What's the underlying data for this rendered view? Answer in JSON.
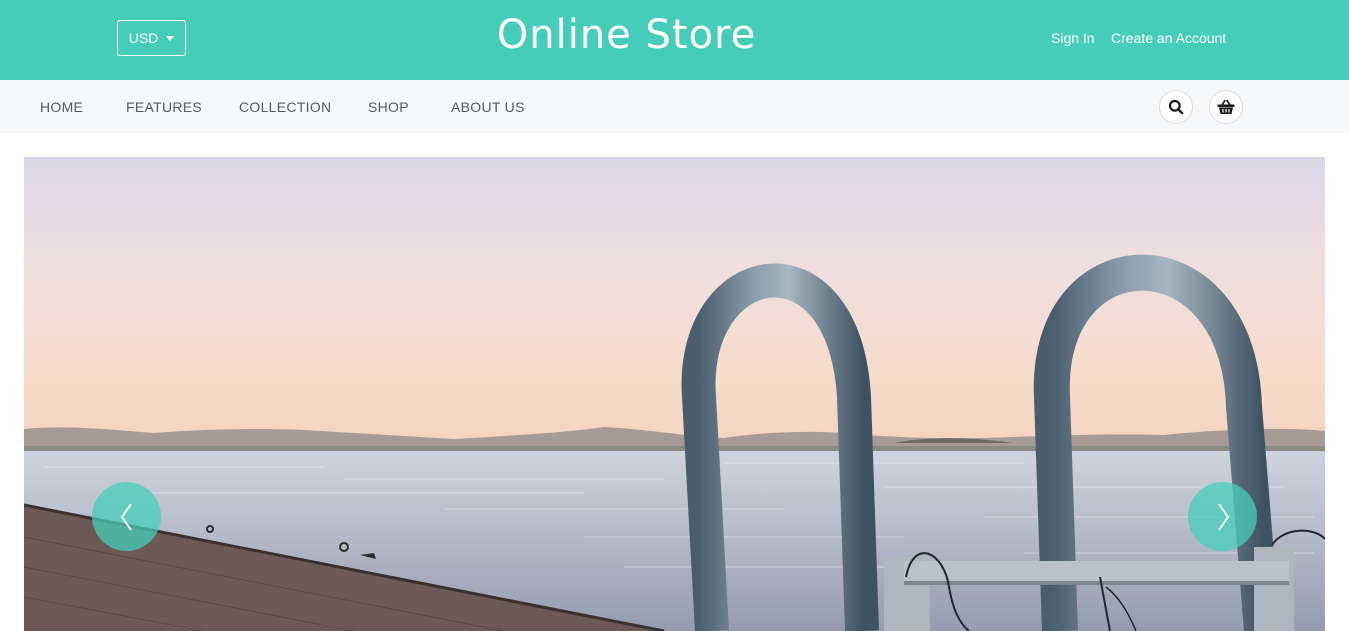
{
  "header": {
    "currency": "USD",
    "brand": "Online Store",
    "sign_in": "Sign In",
    "create_account": "Create an Account"
  },
  "nav": {
    "items": [
      "HOME",
      "FEATURES",
      "COLLECTION",
      "SHOP",
      "ABOUT US"
    ],
    "icons": [
      "search-icon",
      "basket-icon"
    ]
  },
  "carousel": {
    "prev_icon": "chevron-left-icon",
    "next_icon": "chevron-right-icon"
  },
  "colors": {
    "accent": "#46cdba",
    "nav_bg": "#f7f8fa",
    "nav_text": "#555a5f"
  }
}
